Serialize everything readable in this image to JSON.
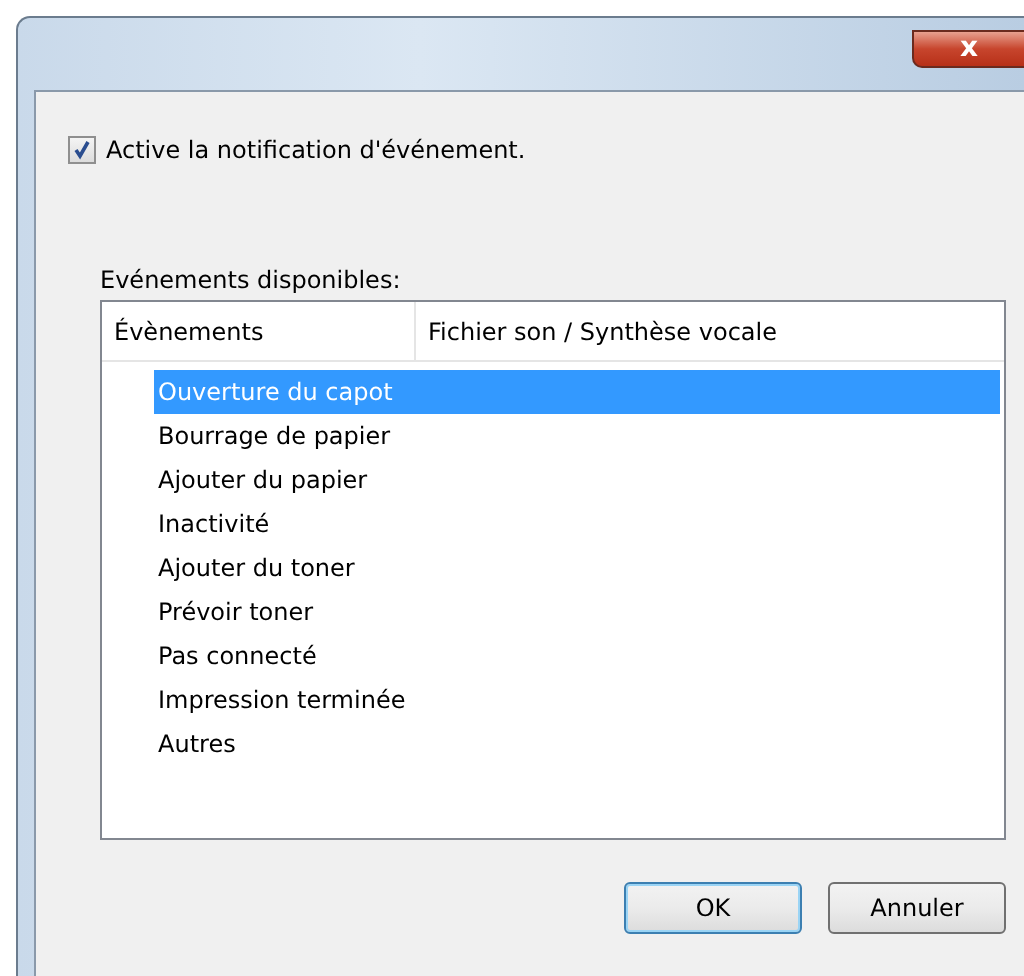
{
  "window": {
    "close_button": "x"
  },
  "enable_checkbox": {
    "label": "Active la notification d'événement.",
    "checked": true
  },
  "events_label": "Evénements disponibles:",
  "table": {
    "columns": [
      "Évènements",
      "Fichier son / Synthèse vocale"
    ],
    "rows": [
      {
        "event": "Ouverture du capot",
        "selected": true
      },
      {
        "event": "Bourrage de papier",
        "selected": false
      },
      {
        "event": "Ajouter du papier",
        "selected": false
      },
      {
        "event": "Inactivité",
        "selected": false
      },
      {
        "event": "Ajouter du toner",
        "selected": false
      },
      {
        "event": "Prévoir toner",
        "selected": false
      },
      {
        "event": "Pas connecté",
        "selected": false
      },
      {
        "event": "Impression terminée",
        "selected": false
      },
      {
        "event": "Autres",
        "selected": false
      }
    ]
  },
  "buttons": [
    {
      "label": "OK",
      "default": true
    },
    {
      "label": "Annuler",
      "default": false
    }
  ]
}
